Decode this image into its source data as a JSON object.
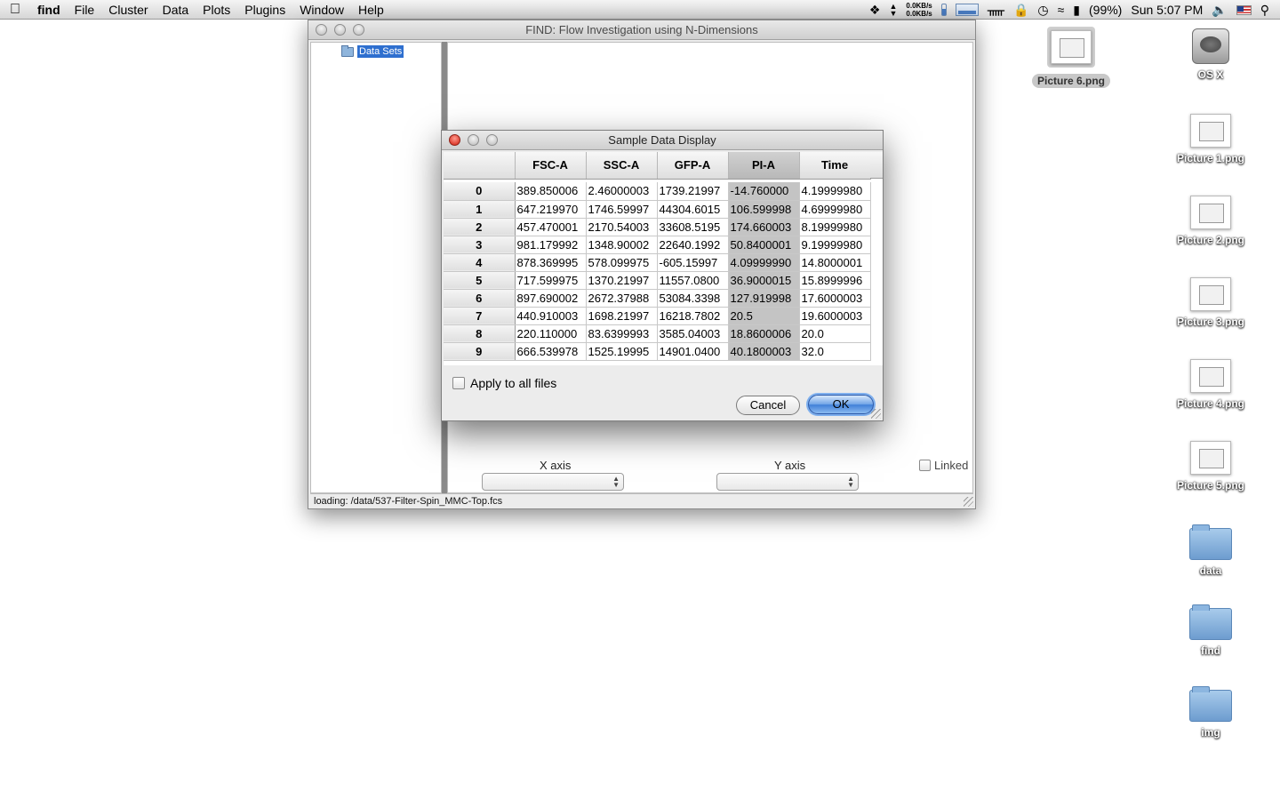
{
  "menubar": {
    "apple_icon": "apple-icon",
    "items": [
      "find",
      "File",
      "Cluster",
      "Data",
      "Plots",
      "Plugins",
      "Window",
      "Help"
    ],
    "net_up": "0.0KB/s",
    "net_down": "0.0KB/s",
    "battery": "(99%)",
    "clock": "Sun 5:07 PM"
  },
  "main_window": {
    "title": "FIND: Flow Investigation using N-Dimensions",
    "tree_root": "Data Sets",
    "x_axis_label": "X axis",
    "y_axis_label": "Y axis",
    "linked_label": "Linked",
    "status": "loading: /data/537-Filter-Spin_MMC-Top.fcs"
  },
  "dialog": {
    "title": "Sample Data Display",
    "columns": [
      "FSC-A",
      "SSC-A",
      "GFP-A",
      "PI-A",
      "Time"
    ],
    "selected_column": "PI-A",
    "rows": [
      {
        "index": "0",
        "cells": [
          "389.850006",
          "2.46000003",
          "1739.21997",
          "-14.760000",
          "4.19999980"
        ]
      },
      {
        "index": "1",
        "cells": [
          "647.219970",
          "1746.59997",
          "44304.6015",
          "106.599998",
          "4.69999980"
        ]
      },
      {
        "index": "2",
        "cells": [
          "457.470001",
          "2170.54003",
          "33608.5195",
          "174.660003",
          "8.19999980"
        ]
      },
      {
        "index": "3",
        "cells": [
          "981.179992",
          "1348.90002",
          "22640.1992",
          "50.8400001",
          "9.19999980"
        ]
      },
      {
        "index": "4",
        "cells": [
          "878.369995",
          "578.099975",
          "-605.15997",
          "4.09999990",
          "14.8000001"
        ]
      },
      {
        "index": "5",
        "cells": [
          "717.599975",
          "1370.21997",
          "11557.0800",
          "36.9000015",
          "15.8999996"
        ]
      },
      {
        "index": "6",
        "cells": [
          "897.690002",
          "2672.37988",
          "53084.3398",
          "127.919998",
          "17.6000003"
        ]
      },
      {
        "index": "7",
        "cells": [
          "440.910003",
          "1698.21997",
          "16218.7802",
          "20.5",
          "19.6000003"
        ]
      },
      {
        "index": "8",
        "cells": [
          "220.110000",
          "83.6399993",
          "3585.04003",
          "18.8600006",
          "20.0"
        ]
      },
      {
        "index": "9",
        "cells": [
          "666.539978",
          "1525.19995",
          "14901.0400",
          "40.1800003",
          "32.0"
        ]
      }
    ],
    "apply_all_label": "Apply to all files",
    "cancel_label": "Cancel",
    "ok_label": "OK"
  },
  "desktop": {
    "icons": [
      {
        "label": "Picture 6.png",
        "type": "picture",
        "selected": true
      },
      {
        "label": "OS X",
        "type": "disk"
      },
      {
        "label": "Picture 1.png",
        "type": "picture"
      },
      {
        "label": "Picture 2.png",
        "type": "picture"
      },
      {
        "label": "Picture 3.png",
        "type": "picture"
      },
      {
        "label": "Picture 4.png",
        "type": "picture"
      },
      {
        "label": "Picture 5.png",
        "type": "picture"
      },
      {
        "label": "data",
        "type": "folder"
      },
      {
        "label": "find",
        "type": "folder"
      },
      {
        "label": "img",
        "type": "folder"
      }
    ]
  }
}
